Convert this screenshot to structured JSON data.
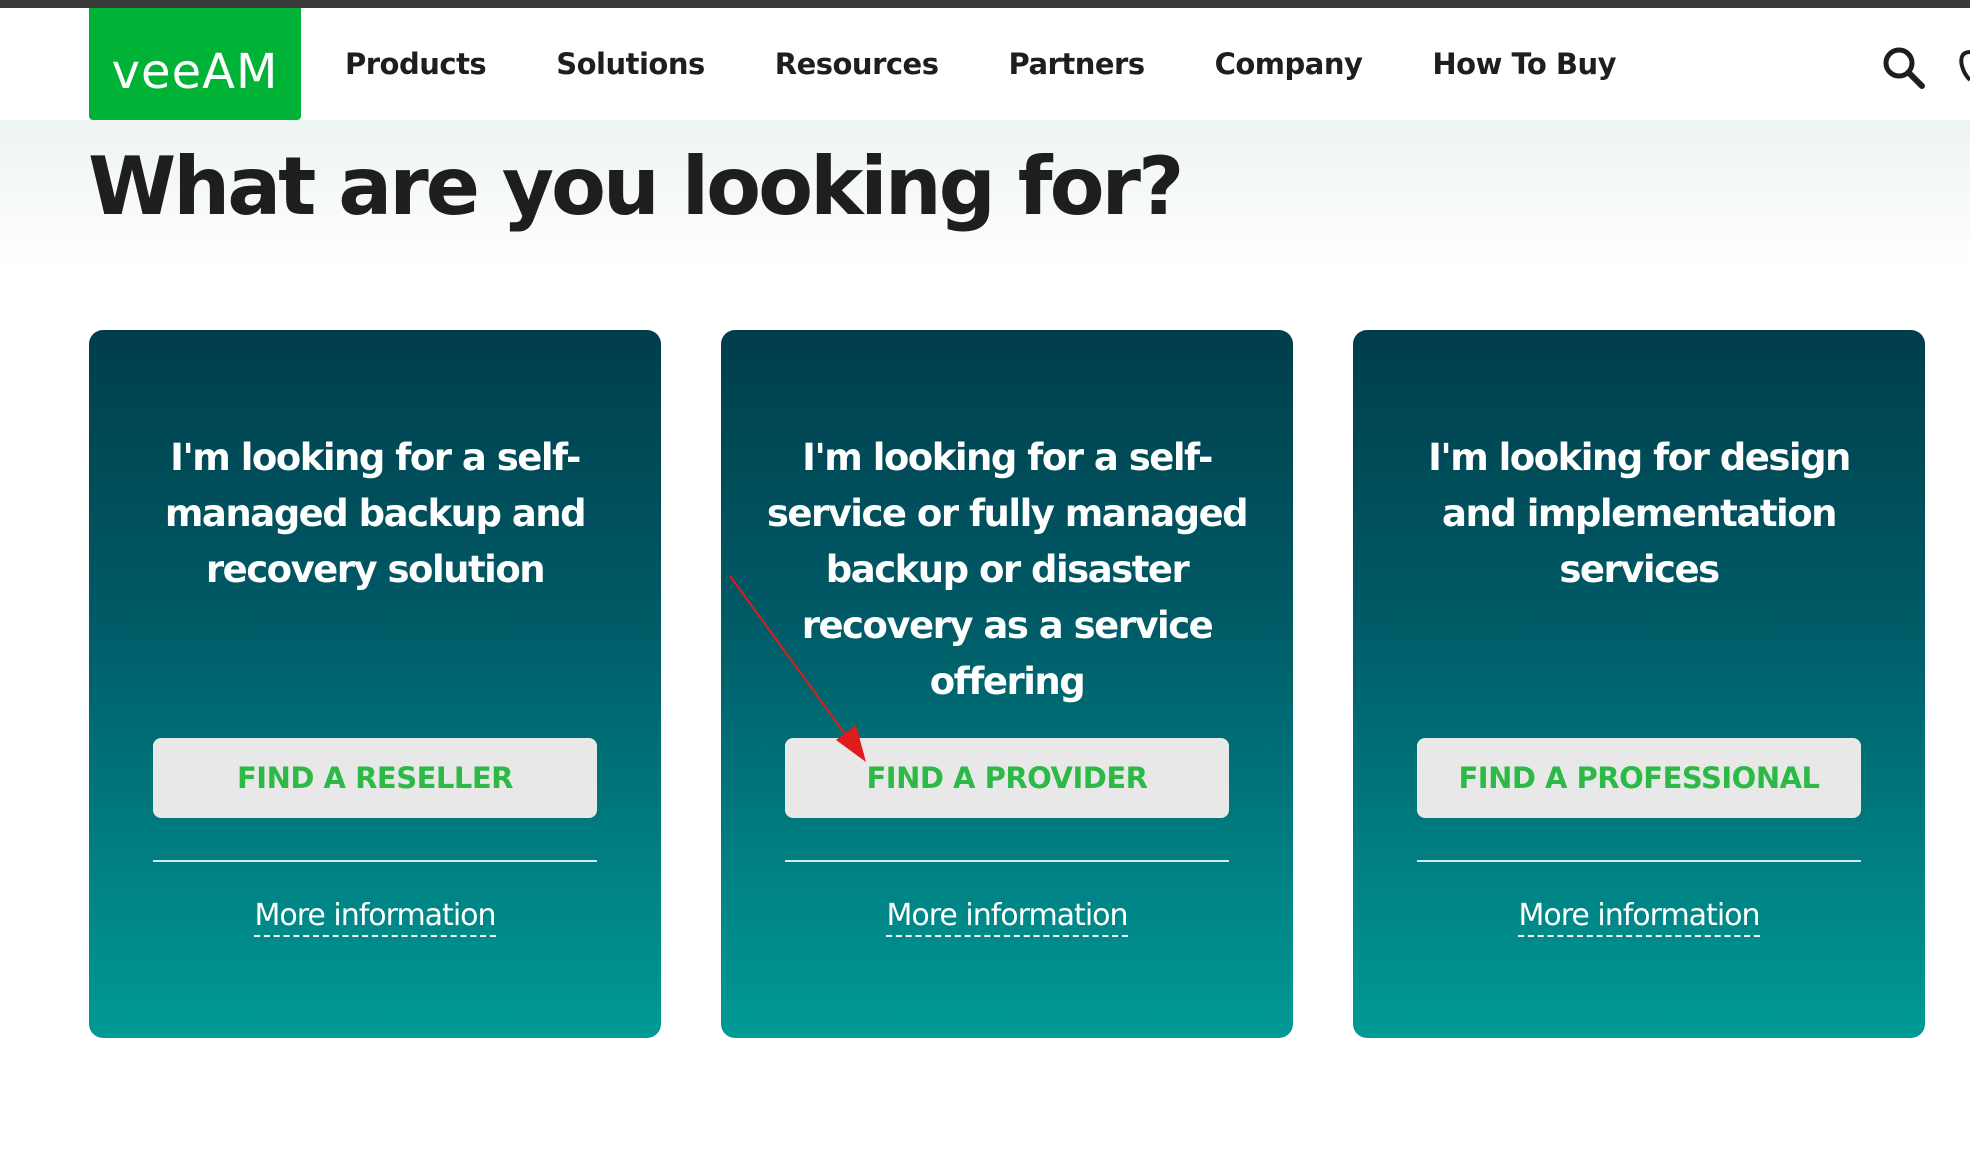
{
  "brand": {
    "logo_text": "veeAM",
    "accent_color": "#00b336"
  },
  "nav": {
    "items": [
      {
        "label": "Products"
      },
      {
        "label": "Solutions"
      },
      {
        "label": "Resources"
      },
      {
        "label": "Partners"
      },
      {
        "label": "Company"
      },
      {
        "label": "How To Buy"
      }
    ],
    "search_icon": "search-icon",
    "user_icon": "user-icon"
  },
  "page": {
    "title": "What are you looking for?"
  },
  "cards": [
    {
      "text": "I'm looking for a self-managed backup and recovery solution",
      "button_label": "FIND A RESELLER",
      "link_label": "More information"
    },
    {
      "text": "I'm looking for a self-service or fully managed backup or disaster recovery as a service offering",
      "button_label": "FIND A PROVIDER",
      "link_label": "More information"
    },
    {
      "text": "I'm looking for design and implementation services",
      "button_label": "FIND A PROFESSIONAL",
      "link_label": "More information"
    }
  ],
  "colors": {
    "card_top": "#003d4b",
    "card_bottom": "#009a95",
    "button_text": "#2db945",
    "annotation_arrow": "#e01b1b"
  }
}
